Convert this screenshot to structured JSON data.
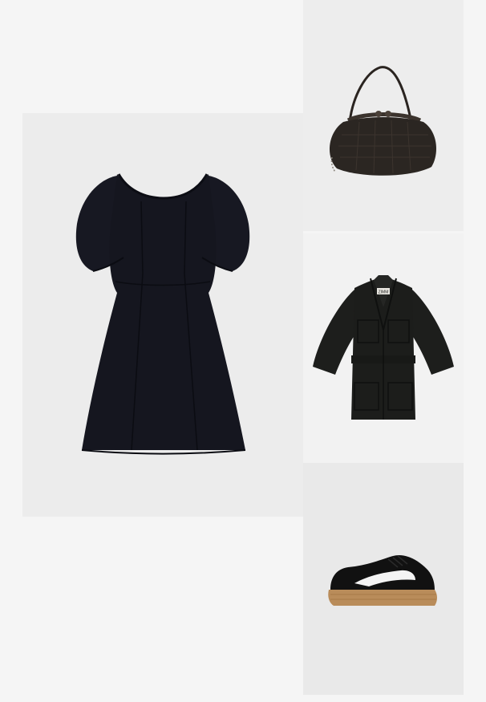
{
  "board": {
    "background": "#f5f5f5",
    "items": [
      {
        "id": "dress",
        "image_name": "black-puff-sleeve-mini-dress-image",
        "color": "#16171f"
      },
      {
        "id": "bag",
        "image_name": "black-frame-clutch-bag-image",
        "color": "#2a2521"
      },
      {
        "id": "jacket",
        "image_name": "black-utility-safari-jacket-image",
        "color": "#1c1d1b"
      },
      {
        "id": "sneaker",
        "image_name": "black-white-platform-sneaker-image",
        "color": "#111111"
      }
    ],
    "jacket_label": "ZIMM"
  }
}
